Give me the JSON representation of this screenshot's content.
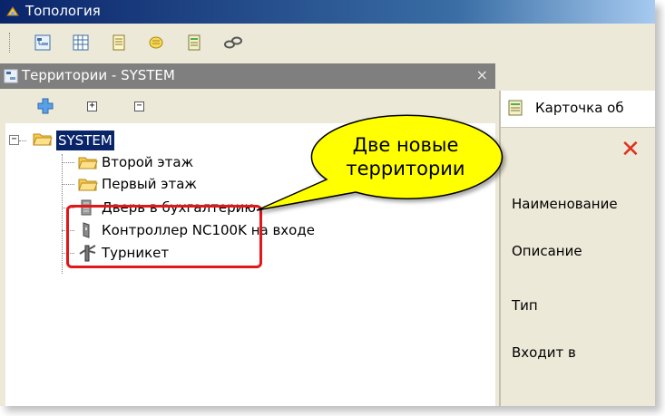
{
  "window": {
    "title": "Топология"
  },
  "toolbar": {
    "icons": [
      "tree-view-icon",
      "grid-view-icon",
      "document-icon",
      "notes-icon",
      "card-icon",
      "link-icon"
    ]
  },
  "left_panel": {
    "title": "Территории - SYSTEM",
    "close_glyph": "×",
    "expand_glyph": "+",
    "collapse_glyph": "−"
  },
  "tree": {
    "root": {
      "label": "SYSTEM",
      "expander": "−"
    },
    "items": [
      {
        "label": "Второй этаж",
        "icon": "folder-icon"
      },
      {
        "label": "Первый этаж",
        "icon": "folder-icon"
      },
      {
        "label": "Дверь в бухгалтерию",
        "icon": "door-icon"
      },
      {
        "label": "Контроллер NC100K на входе",
        "icon": "controller-icon"
      },
      {
        "label": "Турникет",
        "icon": "turnstile-icon"
      }
    ]
  },
  "right_panel": {
    "title": "Карточка об",
    "delete_glyph": "✕",
    "fields": [
      "Наименование",
      "Описание",
      "Тип",
      "Входит в"
    ]
  },
  "callout": {
    "line1": "Две новые",
    "line2": "территории"
  },
  "colors": {
    "title_bar": "#0a246a",
    "selection": "#0a246a",
    "highlight_box": "#e0181a",
    "callout_fill": "#ffff00"
  }
}
